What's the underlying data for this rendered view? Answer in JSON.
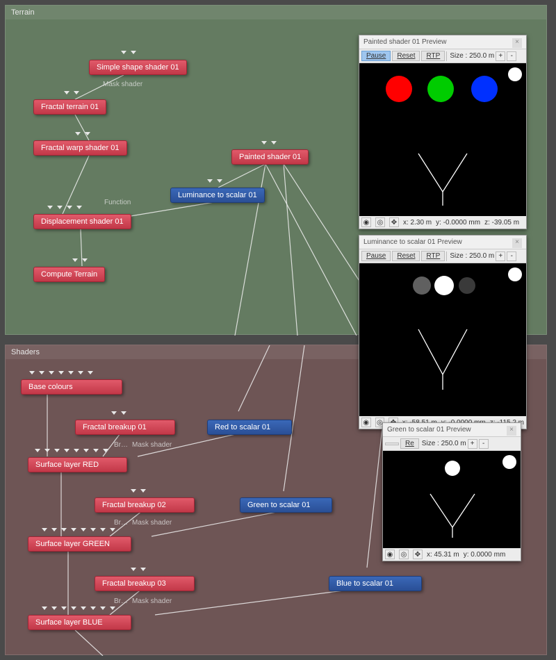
{
  "panels": {
    "terrain": {
      "title": "Terrain"
    },
    "shaders": {
      "title": "Shaders"
    }
  },
  "labels": {
    "mask_shader": "Mask shader",
    "function": "Function",
    "br": "Br…",
    "mask_shader2": "Mask shader"
  },
  "nodes": {
    "simple_shape": "Simple shape shader 01",
    "fractal_terrain": "Fractal terrain 01",
    "fractal_warp": "Fractal warp shader 01",
    "painted_shader": "Painted shader 01",
    "luminance_scalar": "Luminance to scalar 01",
    "displacement": "Displacement shader 01",
    "compute_terrain": "Compute Terrain",
    "base_colours": "Base colours",
    "fractal_breakup1": "Fractal breakup 01",
    "red_scalar": "Red to scalar 01",
    "surface_red": "Surface layer RED",
    "fractal_breakup2": "Fractal breakup 02",
    "green_scalar": "Green to scalar 01",
    "surface_green": "Surface layer GREEN",
    "fractal_breakup3": "Fractal breakup 03",
    "blue_scalar": "Blue to scalar 01",
    "surface_blue": "Surface layer BLUE"
  },
  "previews": {
    "p1": {
      "title": "Painted shader 01 Preview",
      "pause": "Pause",
      "reset": "Reset",
      "rtp": "RTP",
      "size_label": "Size : 250.0 m",
      "x": "x: 2.30 m",
      "y": "y: -0.0000 mm",
      "z": "z: -39.05 m"
    },
    "p2": {
      "title": "Luminance to scalar 01 Preview",
      "pause": "Pause",
      "reset": "Reset",
      "rtp": "RTP",
      "size_label": "Size : 250.0 m",
      "x": "x: -58.51 m",
      "y": "y: -0.0000 mm",
      "z": "z: -115.2 m"
    },
    "p3": {
      "title": "Green to scalar 01 Preview",
      "re": "Re",
      "size_label": "Size : 250.0 m",
      "x": "x: 45.31 m",
      "y": "y: 0.0000 mm"
    }
  }
}
